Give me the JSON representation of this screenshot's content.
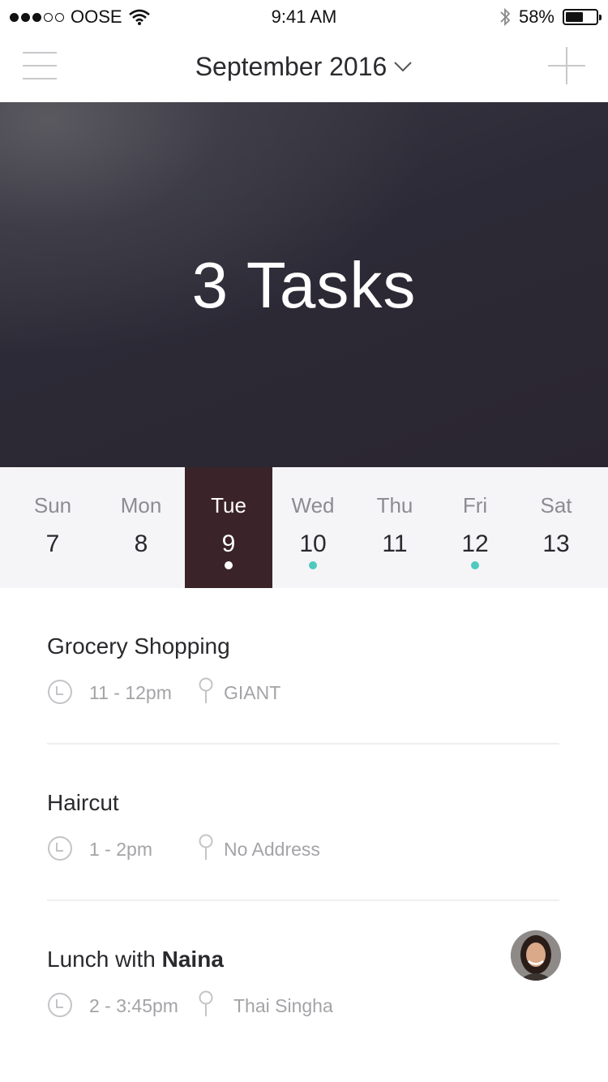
{
  "status_bar": {
    "carrier": "OOSE",
    "time": "9:41 AM",
    "battery_percent": "58%",
    "battery_level": 0.58,
    "signal_bars_filled": 3,
    "signal_bars_total": 5
  },
  "header": {
    "title": "September 2016",
    "menu_icon": "hamburger-menu-icon",
    "dropdown_icon": "chevron-down-icon",
    "add_icon": "plus-icon"
  },
  "hero": {
    "task_count_label": "3 Tasks"
  },
  "week": {
    "selected_index": 2,
    "accent_color": "#4fc9c0",
    "selected_bg": "#3a2329",
    "days": [
      {
        "name": "Sun",
        "number": "7",
        "has_event": false
      },
      {
        "name": "Mon",
        "number": "8",
        "has_event": false
      },
      {
        "name": "Tue",
        "number": "9",
        "has_event": true
      },
      {
        "name": "Wed",
        "number": "10",
        "has_event": true
      },
      {
        "name": "Thu",
        "number": "11",
        "has_event": false
      },
      {
        "name": "Fri",
        "number": "12",
        "has_event": true
      },
      {
        "name": "Sat",
        "number": "13",
        "has_event": false
      }
    ]
  },
  "tasks": [
    {
      "title_prefix": "Grocery Shopping",
      "title_bold": "",
      "time": "11 - 12pm",
      "location": "GIANT",
      "has_avatar": false
    },
    {
      "title_prefix": "Haircut",
      "title_bold": "",
      "time": "1 - 2pm",
      "location": "No Address",
      "has_avatar": false
    },
    {
      "title_prefix": "Lunch with ",
      "title_bold": "Naina",
      "time": "2 - 3:45pm",
      "location": "Thai Singha",
      "has_avatar": true
    }
  ]
}
